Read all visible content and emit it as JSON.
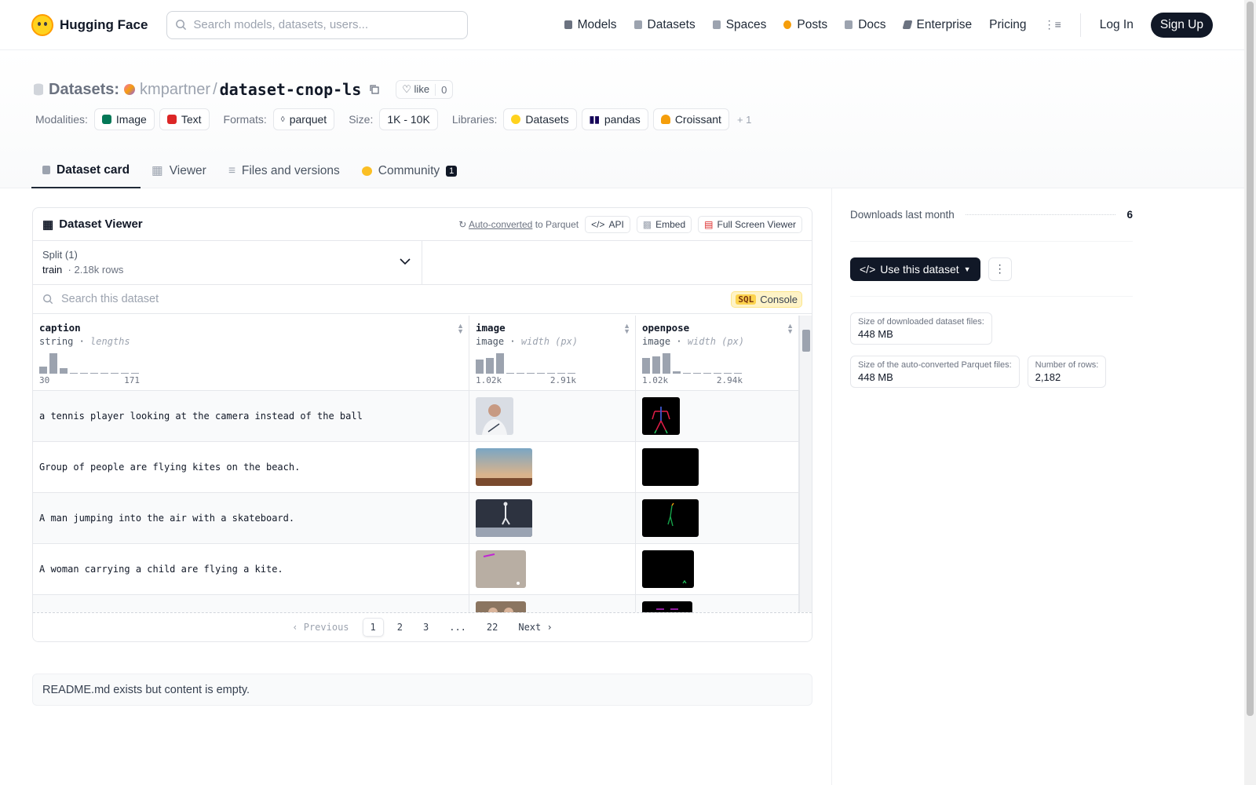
{
  "nav": {
    "brand": "Hugging Face",
    "search_placeholder": "Search models, datasets, users...",
    "links": [
      {
        "label": "Models",
        "color": "#6b7280"
      },
      {
        "label": "Datasets",
        "color": "#9ca3af"
      },
      {
        "label": "Spaces",
        "color": "#9ca3af"
      },
      {
        "label": "Posts",
        "color": "#f59e0b"
      },
      {
        "label": "Docs",
        "color": "#9ca3af"
      },
      {
        "label": "Enterprise",
        "color": "#6b7280"
      }
    ],
    "pricing": "Pricing",
    "login": "Log In",
    "signup": "Sign Up"
  },
  "header": {
    "section": "Datasets:",
    "owner": "kmpartner",
    "separator": "/",
    "name": "dataset-cnop-ls",
    "like_label": "like",
    "like_count": "0",
    "modalities_label": "Modalities:",
    "modalities": [
      "Image",
      "Text"
    ],
    "formats_label": "Formats:",
    "format": "parquet",
    "size_label": "Size:",
    "size": "1K - 10K",
    "libraries_label": "Libraries:",
    "libraries": [
      "Datasets",
      "pandas",
      "Croissant"
    ],
    "more": "+ 1"
  },
  "tabs": [
    {
      "label": "Dataset card"
    },
    {
      "label": "Viewer"
    },
    {
      "label": "Files and versions"
    },
    {
      "label": "Community",
      "badge": "1"
    }
  ],
  "viewer": {
    "title": "Dataset Viewer",
    "auto_converted": "Auto-converted",
    "to_parquet": "to Parquet",
    "api": "API",
    "embed": "Embed",
    "fullscreen": "Full Screen Viewer",
    "split_label": "Split (1)",
    "split_name": "train",
    "split_rows": "2.18k rows",
    "search_placeholder": "Search this dataset",
    "sql_tag": "SQL",
    "console": "Console",
    "columns": [
      {
        "name": "caption",
        "type": "string",
        "stat": "lengths",
        "min": "30",
        "max": "171",
        "hist": [
          0.35,
          1.0,
          0.25,
          0.05,
          0.03,
          0.03,
          0.03,
          0.03,
          0.03,
          0.03
        ]
      },
      {
        "name": "image",
        "type": "image",
        "stat": "width (px)",
        "min": "1.02k",
        "max": "2.91k",
        "hist": [
          0.7,
          0.75,
          1.0,
          0.05,
          0.05,
          0.03,
          0.03,
          0.03,
          0.03,
          0.03
        ]
      },
      {
        "name": "openpose",
        "type": "image",
        "stat": "width (px)",
        "min": "1.02k",
        "max": "2.94k",
        "hist": [
          0.75,
          0.85,
          1.0,
          0.12,
          0.05,
          0.03,
          0.03,
          0.03,
          0.03,
          0.03
        ]
      }
    ],
    "rows": [
      {
        "caption": "a tennis player looking at the camera instead of the ball"
      },
      {
        "caption": "Group of people are flying kites on the beach."
      },
      {
        "caption": "A man jumping into the air with a skateboard."
      },
      {
        "caption": "A woman carrying a child are flying a kite."
      },
      {
        "caption": ""
      }
    ],
    "pager": {
      "prev": "Previous",
      "pages": [
        "1",
        "2",
        "3",
        "...",
        "22"
      ],
      "next": "Next"
    }
  },
  "readme": "README.md exists but content is empty.",
  "sidebar": {
    "downloads_label": "Downloads last month",
    "downloads": "6",
    "use_button": "Use this dataset",
    "stats": [
      {
        "k": "Size of downloaded dataset files:",
        "v": "448 MB"
      },
      {
        "k": "Size of the auto-converted Parquet files:",
        "v": "448 MB"
      },
      {
        "k": "Number of rows:",
        "v": "2,182"
      }
    ]
  }
}
